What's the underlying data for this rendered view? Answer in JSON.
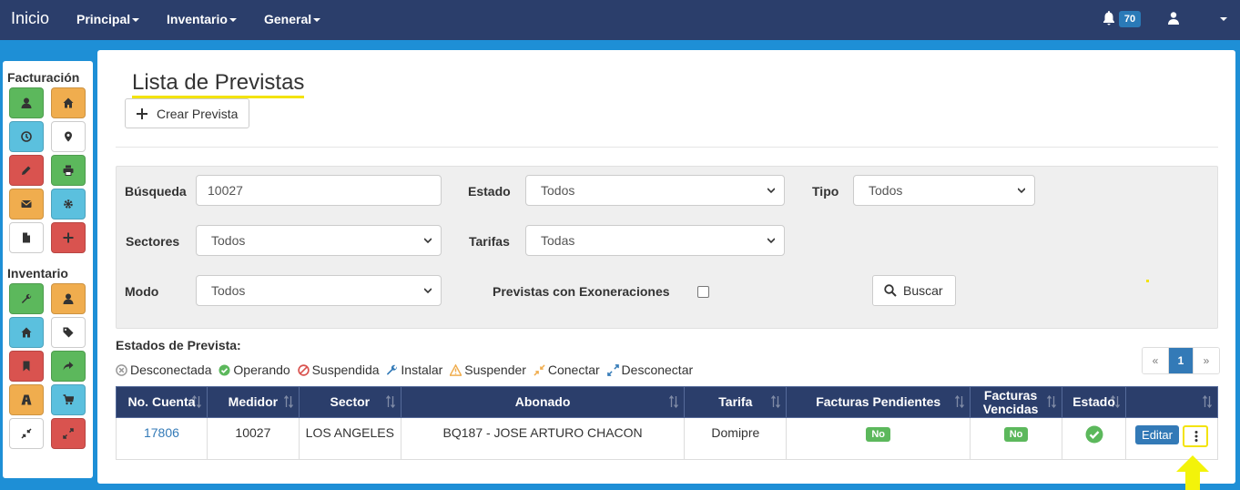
{
  "navbar": {
    "brand": "Inicio",
    "menus": [
      "Principal",
      "Inventario",
      "General"
    ],
    "notifications_count": "70",
    "bell_icon": "bell-icon",
    "user_icon": "user-icon"
  },
  "sidebar": {
    "sections": [
      {
        "title": "Facturación",
        "buttons": [
          {
            "icon": "user-icon",
            "color": "#5cb85c"
          },
          {
            "icon": "home-icon",
            "color": "#f0ad4e"
          },
          {
            "icon": "clock-icon",
            "color": "#5bc0de"
          },
          {
            "icon": "map-marker-icon",
            "color": "#ffffff"
          },
          {
            "icon": "pencil-icon",
            "color": "#d9534f"
          },
          {
            "icon": "print-icon",
            "color": "#5cb85c"
          },
          {
            "icon": "envelope-icon",
            "color": "#f0ad4e"
          },
          {
            "icon": "gear-icon",
            "color": "#5bc0de"
          },
          {
            "icon": "file-icon",
            "color": "#ffffff"
          },
          {
            "icon": "plus-icon",
            "color": "#d9534f"
          }
        ]
      },
      {
        "title": "Inventario",
        "buttons": [
          {
            "icon": "wrench-icon",
            "color": "#5cb85c"
          },
          {
            "icon": "user-icon",
            "color": "#f0ad4e"
          },
          {
            "icon": "home-icon",
            "color": "#5bc0de"
          },
          {
            "icon": "tag-icon",
            "color": "#ffffff"
          },
          {
            "icon": "bookmark-icon",
            "color": "#d9534f"
          },
          {
            "icon": "share-icon",
            "color": "#5cb85c"
          },
          {
            "icon": "road-icon",
            "color": "#f0ad4e"
          },
          {
            "icon": "cart-icon",
            "color": "#5bc0de"
          },
          {
            "icon": "compress-icon",
            "color": "#ffffff"
          },
          {
            "icon": "expand-icon",
            "color": "#d9534f"
          }
        ]
      }
    ]
  },
  "page": {
    "title": "Lista de Previstas",
    "create_button": "Crear Prevista"
  },
  "filters": {
    "busqueda_label": "Búsqueda",
    "busqueda_value": "10027",
    "estado_label": "Estado",
    "estado_value": "Todos",
    "tipo_label": "Tipo",
    "tipo_value": "Todos",
    "sectores_label": "Sectores",
    "sectores_value": "Todos",
    "tarifas_label": "Tarifas",
    "tarifas_value": "Todas",
    "modo_label": "Modo",
    "modo_value": "Todos",
    "exoneraciones_label": "Previstas con Exoneraciones",
    "exoneraciones_checked": false,
    "search_button": "Buscar"
  },
  "legend": {
    "title": "Estados de Prevista:",
    "items": [
      {
        "label": "Desconectada",
        "icon": "times-circle-icon",
        "color": "#999999"
      },
      {
        "label": "Operando",
        "icon": "check-circle-icon",
        "color": "#5cb85c"
      },
      {
        "label": "Suspendida",
        "icon": "ban-icon",
        "color": "#d9534f"
      },
      {
        "label": "Instalar",
        "icon": "wrench-icon",
        "color": "#337ab7"
      },
      {
        "label": "Suspender",
        "icon": "warning-icon",
        "color": "#f0ad4e"
      },
      {
        "label": "Conectar",
        "icon": "compress-icon",
        "color": "#f0ad4e"
      },
      {
        "label": "Desconectar",
        "icon": "expand-icon",
        "color": "#337ab7"
      }
    ]
  },
  "pagination": {
    "prev": "«",
    "current": "1",
    "next": "»"
  },
  "table": {
    "headers": [
      "No. Cuenta",
      "Medidor",
      "Sector",
      "Abonado",
      "Tarifa",
      "Facturas Pendientes",
      "Facturas Vencidas",
      "Estado",
      ""
    ],
    "rows": [
      {
        "cuenta": "17806",
        "medidor": "10027",
        "sector": "LOS ANGELES",
        "abonado": "BQ187 - JOSE ARTURO CHACON",
        "tarifa": "Domipre",
        "pendientes": "No",
        "vencidas": "No",
        "estado_icon": "check-circle-icon",
        "edit_button": "Editar",
        "more_icon": "ellipsis-vertical-icon"
      }
    ]
  },
  "colors": {
    "navbar": "#2b3e6b",
    "background": "#1e8fd6",
    "highlight": "#f3e30a",
    "primary": "#337ab7",
    "success": "#5cb85c"
  }
}
